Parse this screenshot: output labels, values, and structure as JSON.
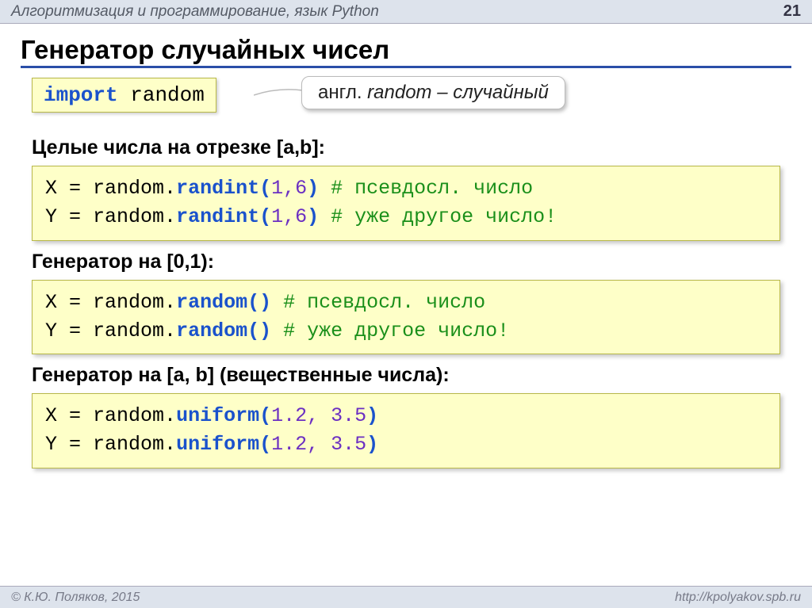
{
  "header": {
    "title": "Алгоритмизация и программирование, язык Python",
    "page": "21"
  },
  "title": "Генератор случайных чисел",
  "import_line": {
    "kw": "import",
    "mod": "random"
  },
  "callout": {
    "prefix": "англ. ",
    "word": "random",
    "suffix": " – случайный"
  },
  "sections": [
    {
      "head": "Целые числа на отрезке [a,b]:",
      "lines": [
        {
          "var": "X",
          "eq": " = ",
          "mod": "random.",
          "fn": "randint(",
          "args": "1,6",
          "close": ")",
          "cmt": " # псевдосл. число"
        },
        {
          "var": "Y",
          "eq": " = ",
          "mod": "random.",
          "fn": "randint(",
          "args": "1,6",
          "close": ")",
          "cmt": " # уже другое число!"
        }
      ]
    },
    {
      "head": "Генератор на [0,1):",
      "lines": [
        {
          "var": "X",
          "eq": " = ",
          "mod": "random.",
          "fn": "random()",
          "args": "",
          "close": "",
          "cmt": "   # псевдосл. число"
        },
        {
          "var": "Y",
          "eq": " = ",
          "mod": "random.",
          "fn": "random()",
          "args": "",
          "close": "",
          "cmt": "   # уже другое число!"
        }
      ]
    },
    {
      "head": "Генератор на [a, b] (вещественные числа):",
      "lines": [
        {
          "var": "X",
          "eq": " = ",
          "mod": "random.",
          "fn": "uniform(",
          "args": "1.2, 3.5",
          "close": ")",
          "cmt": ""
        },
        {
          "var": "Y",
          "eq": " = ",
          "mod": "random.",
          "fn": "uniform(",
          "args": "1.2, 3.5",
          "close": ")",
          "cmt": ""
        }
      ]
    }
  ],
  "footer": {
    "copyright": "© К.Ю. Поляков, 2015",
    "url": "http://kpolyakov.spb.ru"
  }
}
